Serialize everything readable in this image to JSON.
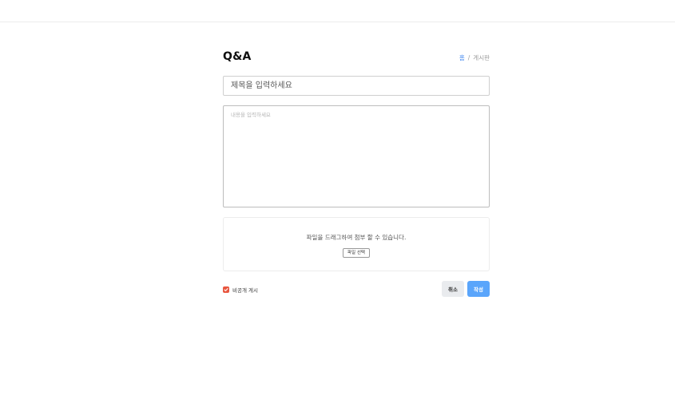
{
  "header": {
    "title": "Q&A",
    "breadcrumb": {
      "home": "홈",
      "separator": "/",
      "current": "게시판"
    }
  },
  "form": {
    "title_placeholder": "제목을 입력하세요",
    "title_value": "",
    "content_placeholder": "내용을 입력하세요",
    "content_value": ""
  },
  "dropzone": {
    "message": "파일을 드래그하여 첨부 할 수 있습니다.",
    "select_label": "파일 선택"
  },
  "footer": {
    "private_label": "비공개 게시",
    "private_checked": true,
    "cancel_label": "취소",
    "submit_label": "작성"
  },
  "colors": {
    "accent": "#5aa5fb",
    "checkbox": "#e8563f",
    "breadcrumb_home": "#4a8cf0"
  }
}
